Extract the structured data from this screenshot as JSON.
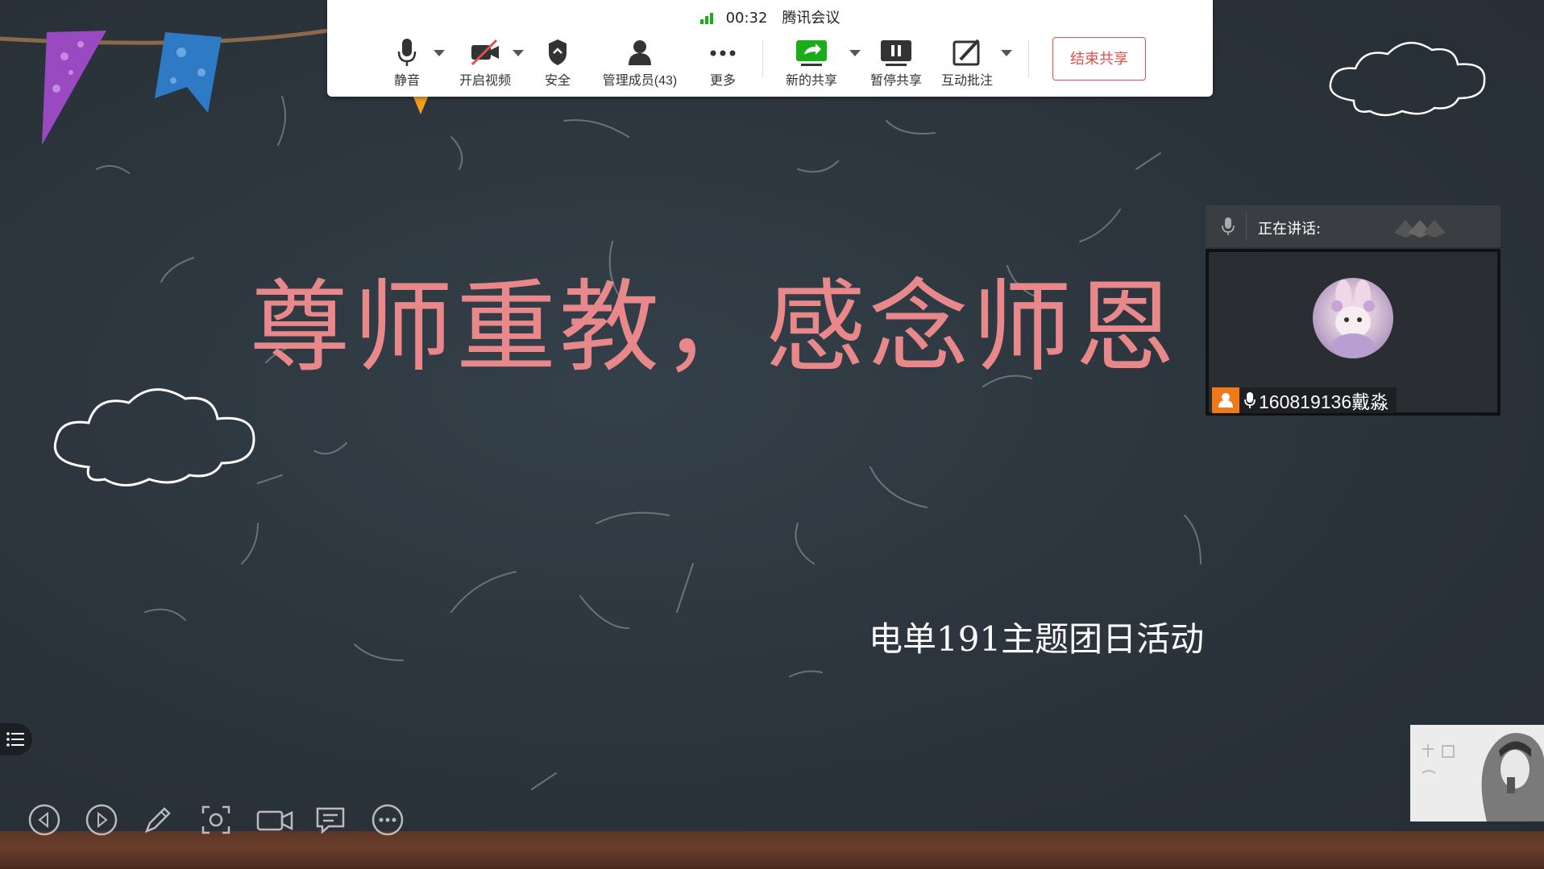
{
  "toolbar": {
    "timer": "00:32",
    "app_name": "腾讯会议",
    "items": {
      "mute": "静音",
      "video": "开启视频",
      "security": "安全",
      "members": "管理成员(43)",
      "more": "更多",
      "new_share": "新的共享",
      "pause_share": "暂停共享",
      "annotate": "互动批注"
    },
    "end_share": "结束共享"
  },
  "slide": {
    "title": "尊师重教，感念师恩",
    "subtitle": "电单191主题团日活动"
  },
  "speaker_panel": {
    "label": "正在讲话:",
    "participant_name": "160819136戴淼"
  },
  "colors": {
    "board": "#2d353e",
    "title": "#e8888a",
    "end_share": "#e34d4d",
    "signal": "#1aad19",
    "user_badge": "#f07a1a"
  },
  "icons": [
    "mic-icon",
    "video-off-icon",
    "shield-icon",
    "members-icon",
    "more-icon",
    "share-icon",
    "pause-icon",
    "annotate-icon",
    "prev-icon",
    "next-icon",
    "pen-icon",
    "screenshot-icon",
    "camera-icon",
    "comment-icon",
    "more-circle-icon",
    "list-menu-icon"
  ]
}
